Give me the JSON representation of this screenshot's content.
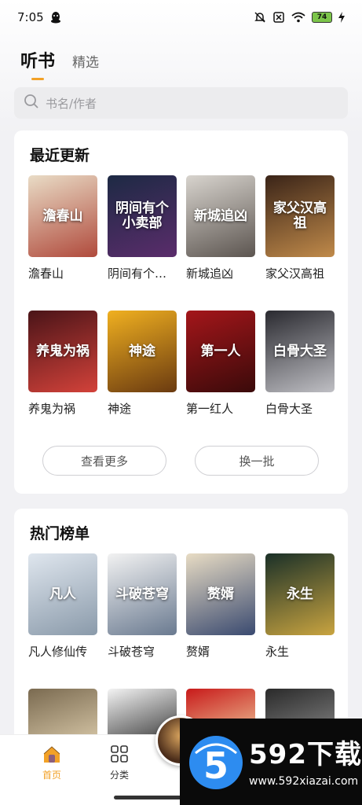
{
  "status": {
    "time": "7:05",
    "battery": "74"
  },
  "tabs": {
    "active": "听书",
    "other": "精选"
  },
  "search": {
    "placeholder": "书名/作者"
  },
  "recent": {
    "title": "最近更新",
    "books": [
      {
        "name": "澹春山",
        "cover_text": "澹春山",
        "colors": [
          "#e9dcc6",
          "#b04a3c"
        ]
      },
      {
        "name": "阴间有个…",
        "cover_text": "阴间有个小卖部",
        "colors": [
          "#1d2a44",
          "#5a2c6b"
        ]
      },
      {
        "name": "新城追凶",
        "cover_text": "新城追凶",
        "colors": [
          "#d8d4ce",
          "#5c5550"
        ]
      },
      {
        "name": "家父汉高祖",
        "cover_text": "家父汉高祖",
        "colors": [
          "#3a2418",
          "#c08a4a"
        ]
      },
      {
        "name": "养鬼为祸",
        "cover_text": "养鬼为祸",
        "colors": [
          "#4a1418",
          "#d3423a"
        ]
      },
      {
        "name": "神途",
        "cover_text": "神途",
        "colors": [
          "#f0b020",
          "#6a3a10"
        ]
      },
      {
        "name": "第一红人",
        "cover_text": "第一人",
        "colors": [
          "#a4161a",
          "#3a0a0a"
        ]
      },
      {
        "name": "白骨大圣",
        "cover_text": "白骨大圣",
        "colors": [
          "#2a2a30",
          "#bfbfc4"
        ]
      }
    ],
    "more_button": "查看更多",
    "refresh_button": "换一批"
  },
  "hot": {
    "title": "热门榜单",
    "books": [
      {
        "name": "凡人修仙传",
        "cover_text": "凡人",
        "colors": [
          "#dfe6ee",
          "#8a9aaa"
        ]
      },
      {
        "name": "斗破苍穹",
        "cover_text": "斗破苍穹",
        "colors": [
          "#f2f2f2",
          "#6a7a90"
        ]
      },
      {
        "name": "赘婿",
        "cover_text": "赘婿",
        "colors": [
          "#e8dcc4",
          "#3a4a70"
        ]
      },
      {
        "name": "永生",
        "cover_text": "永生",
        "colors": [
          "#1a3028",
          "#c9a440"
        ]
      }
    ],
    "partial_colors": [
      [
        "#7a6a50",
        "#d8c8a8"
      ],
      [
        "#f4f4f4",
        "#333333"
      ],
      [
        "#c81a1a",
        "#f0d0a0"
      ],
      [
        "#2a2a2a",
        "#8a8a8a"
      ]
    ]
  },
  "nav": {
    "home": "首页",
    "category": "分类"
  },
  "watermark": {
    "title": "592下载",
    "url": "www.592xiazai.com",
    "logo": "5"
  },
  "colors": {
    "accent": "#f2a127",
    "nav_active": "#f2a127"
  }
}
